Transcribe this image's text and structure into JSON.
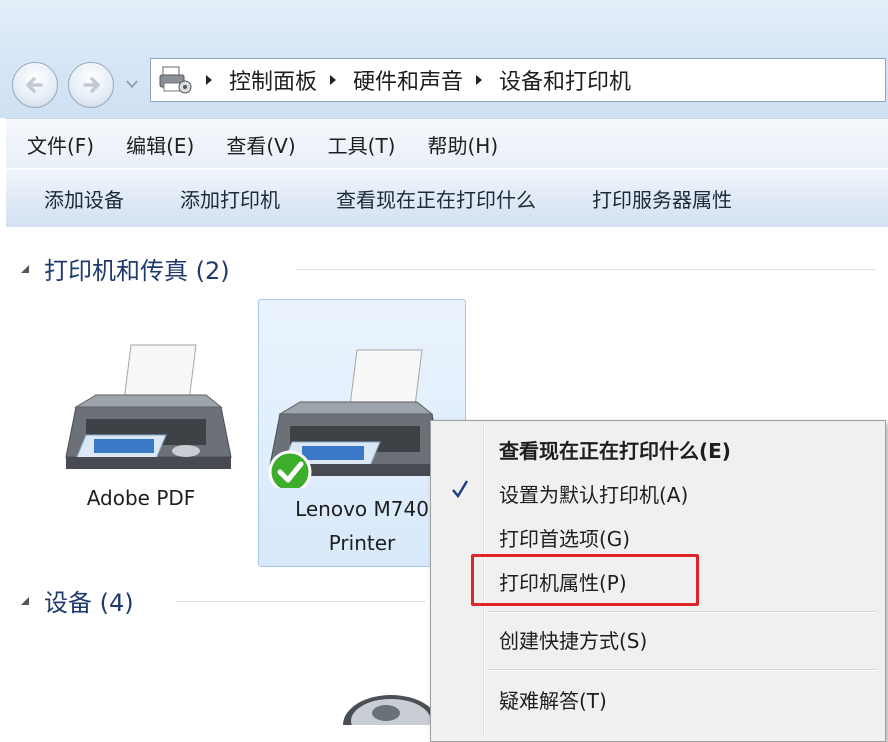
{
  "address": {
    "crumbs": [
      "控制面板",
      "硬件和声音",
      "设备和打印机"
    ]
  },
  "menubar": {
    "items": [
      "文件(F)",
      "编辑(E)",
      "查看(V)",
      "工具(T)",
      "帮助(H)"
    ]
  },
  "commandbar": {
    "items": [
      "添加设备",
      "添加打印机",
      "查看现在正在打印什么",
      "打印服务器属性"
    ]
  },
  "groups": {
    "printers": {
      "title": "打印机和传真 (2)"
    },
    "devices": {
      "title": "设备 (4)"
    }
  },
  "printers": [
    {
      "label": "Adobe PDF"
    },
    {
      "label_line1": "Lenovo M740",
      "label_line2": "Printer",
      "default": true
    }
  ],
  "context_menu": {
    "items": [
      "查看现在正在打印什么(E)",
      "设置为默认打印机(A)",
      "打印首选项(G)",
      "打印机属性(P)",
      "创建快捷方式(S)",
      "疑难解答(T)"
    ]
  },
  "colors": {
    "highlight_border": "#e0252b",
    "default_badge": "#3cae2c"
  }
}
